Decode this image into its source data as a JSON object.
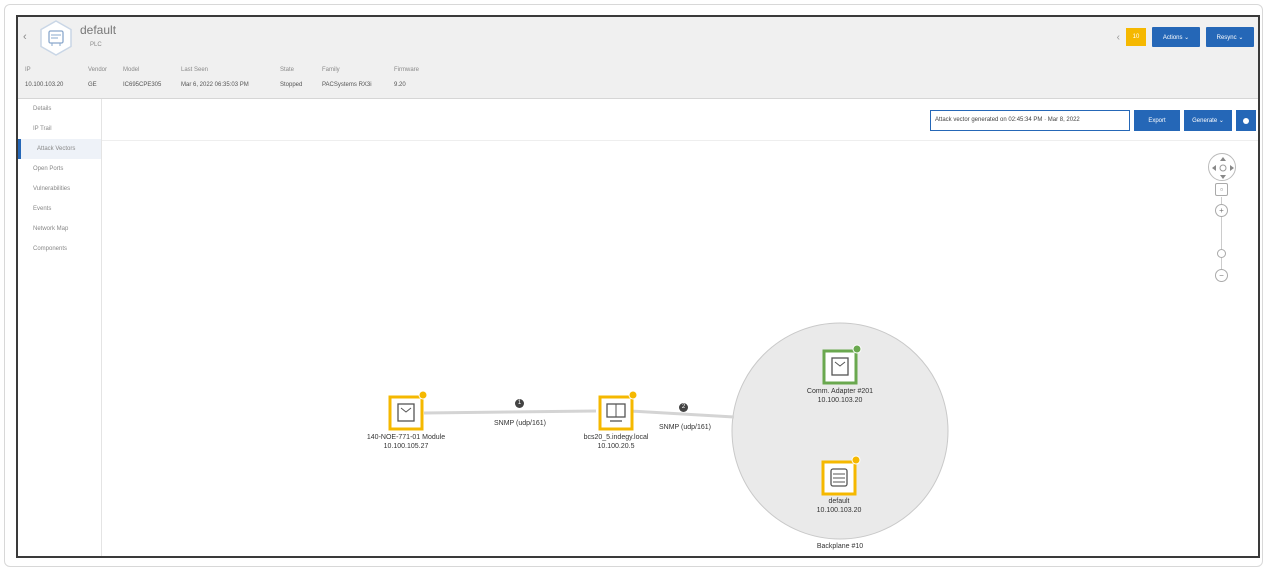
{
  "header": {
    "back_label": "‹",
    "asset_name": "default",
    "asset_type": "PLC",
    "meta": [
      {
        "label": "IP",
        "value": "10.100.103.20"
      },
      {
        "label": "Vendor",
        "value": "GE"
      },
      {
        "label": "Model",
        "value": "IC695CPE305"
      },
      {
        "label": "Last Seen",
        "value": "Mar 6, 2022 06:35:03 PM"
      },
      {
        "label": "State",
        "value": "Stopped"
      },
      {
        "label": "Family",
        "value": "PACSystems RX3i"
      },
      {
        "label": "Firmware",
        "value": "9.20"
      }
    ],
    "badge": "10",
    "actions_label": "Actions ⌄",
    "resync_label": "Resync ⌄"
  },
  "sidebar": {
    "items": [
      {
        "label": "Details"
      },
      {
        "label": "IP Trail"
      },
      {
        "label": "Attack Vectors"
      },
      {
        "label": "Open Ports"
      },
      {
        "label": "Vulnerabilities"
      },
      {
        "label": "Events"
      },
      {
        "label": "Network Map"
      },
      {
        "label": "Components"
      }
    ]
  },
  "toolbar": {
    "vector_select": "Attack vector generated on 02:45:34 PM · Mar 8, 2022",
    "export_label": "Export",
    "generate_label": "Generate ⌄"
  },
  "graph": {
    "nodes": [
      {
        "name": "140-NOE-771-01 Module",
        "ip": "10.100.105.27"
      },
      {
        "name": "bcs20_5.indegy.local",
        "ip": "10.100.20.5"
      },
      {
        "name": "Comm. Adapter #201",
        "ip": "10.100.103.20"
      },
      {
        "name": "default",
        "ip": "10.100.103.20"
      }
    ],
    "edges": [
      {
        "step": "1",
        "label": "SNMP (udp/161)"
      },
      {
        "step": "2",
        "label": "SNMP (udp/161)"
      }
    ],
    "group_label": "Backplane #10"
  },
  "colors": {
    "accent": "#2567b7",
    "warning": "#f5b800",
    "ok": "#6aa84f"
  }
}
